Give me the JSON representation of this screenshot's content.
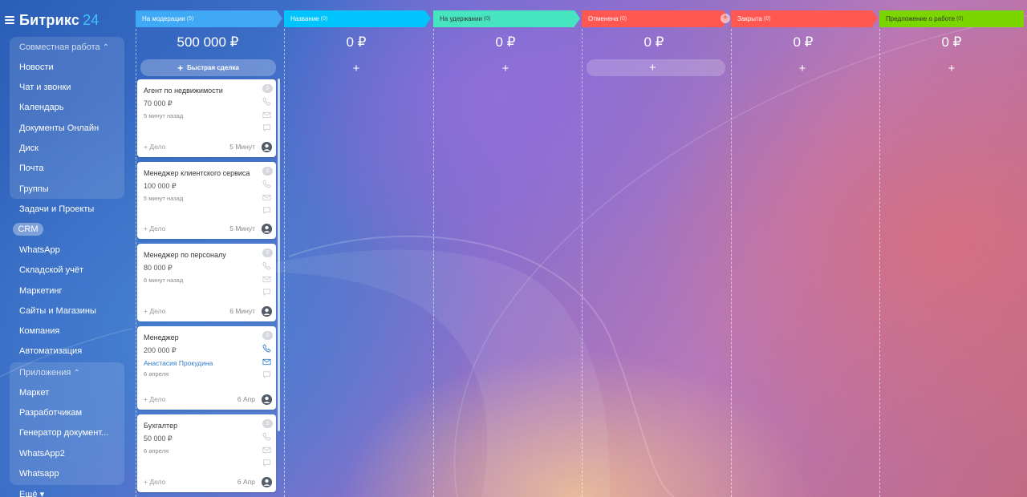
{
  "app": {
    "logo_name": "Битрикс",
    "logo_num": "24"
  },
  "sidebar": {
    "group1_head": "Совместная работа",
    "group1_items": [
      {
        "label": "Новости"
      },
      {
        "label": "Чат и звонки"
      },
      {
        "label": "Календарь"
      },
      {
        "label": "Документы Онлайн"
      },
      {
        "label": "Диск"
      },
      {
        "label": "Почта"
      },
      {
        "label": "Группы"
      }
    ],
    "items": [
      {
        "label": "Задачи и Проекты"
      },
      {
        "label": "CRM"
      },
      {
        "label": "WhatsApp"
      },
      {
        "label": "Складской учёт"
      },
      {
        "label": "Маркетинг"
      },
      {
        "label": "Сайты и Магазины"
      },
      {
        "label": "Компания"
      },
      {
        "label": "Автоматизация"
      }
    ],
    "group2_head": "Приложения",
    "group2_items": [
      {
        "label": "Маркет"
      },
      {
        "label": "Разработчикам"
      },
      {
        "label": "Генератор документ..."
      },
      {
        "label": "WhatsApp2"
      },
      {
        "label": "Whatsapp"
      }
    ],
    "more": "Ещё"
  },
  "stages": [
    {
      "name": "На модерации",
      "count": "(5)",
      "color": "#3fa9f5",
      "sum": "500 000 ₽"
    },
    {
      "name": "Название",
      "count": "(0)",
      "color": "#00c4fb",
      "sum": "0 ₽"
    },
    {
      "name": "На удержании",
      "count": "(0)",
      "color": "#47e4c2",
      "sum": "0 ₽"
    },
    {
      "name": "Отменена",
      "count": "(0)",
      "color": "#ff5752",
      "sum": "0 ₽"
    },
    {
      "name": "Закрыта",
      "count": "(0)",
      "color": "#ff5752",
      "sum": "0 ₽"
    },
    {
      "name": "Предложение о работе",
      "count": "(0)",
      "color": "#7bd500",
      "sum": "0 ₽"
    }
  ],
  "quick_deal": "Быстрая сделка",
  "plus": "+",
  "cards": [
    {
      "title": "Агент по недвижимости",
      "price": "70 000 ₽",
      "meta": "5 минут назад",
      "badge": "0",
      "add": "+ Дело",
      "when": "5 Минут"
    },
    {
      "title": "Менеджер клиентского сервиса",
      "price": "100 000 ₽",
      "meta": "5 минут назад",
      "badge": "0",
      "add": "+ Дело",
      "when": "5 Минут"
    },
    {
      "title": "Менеджер по персоналу",
      "price": "80 000 ₽",
      "meta": "6 минут назад",
      "badge": "0",
      "add": "+ Дело",
      "when": "6 Минут"
    },
    {
      "title": "Менеджер",
      "price": "200 000 ₽",
      "meta": "Анастасия Прокудина",
      "meta2": "6 апреля",
      "badge": "0",
      "add": "+ Дело",
      "when": "6 Апр"
    },
    {
      "title": "Бухгалтер",
      "price": "50 000 ₽",
      "meta": "6 апреля",
      "badge": "0",
      "add": "+ Дело",
      "when": "6 Апр"
    }
  ]
}
